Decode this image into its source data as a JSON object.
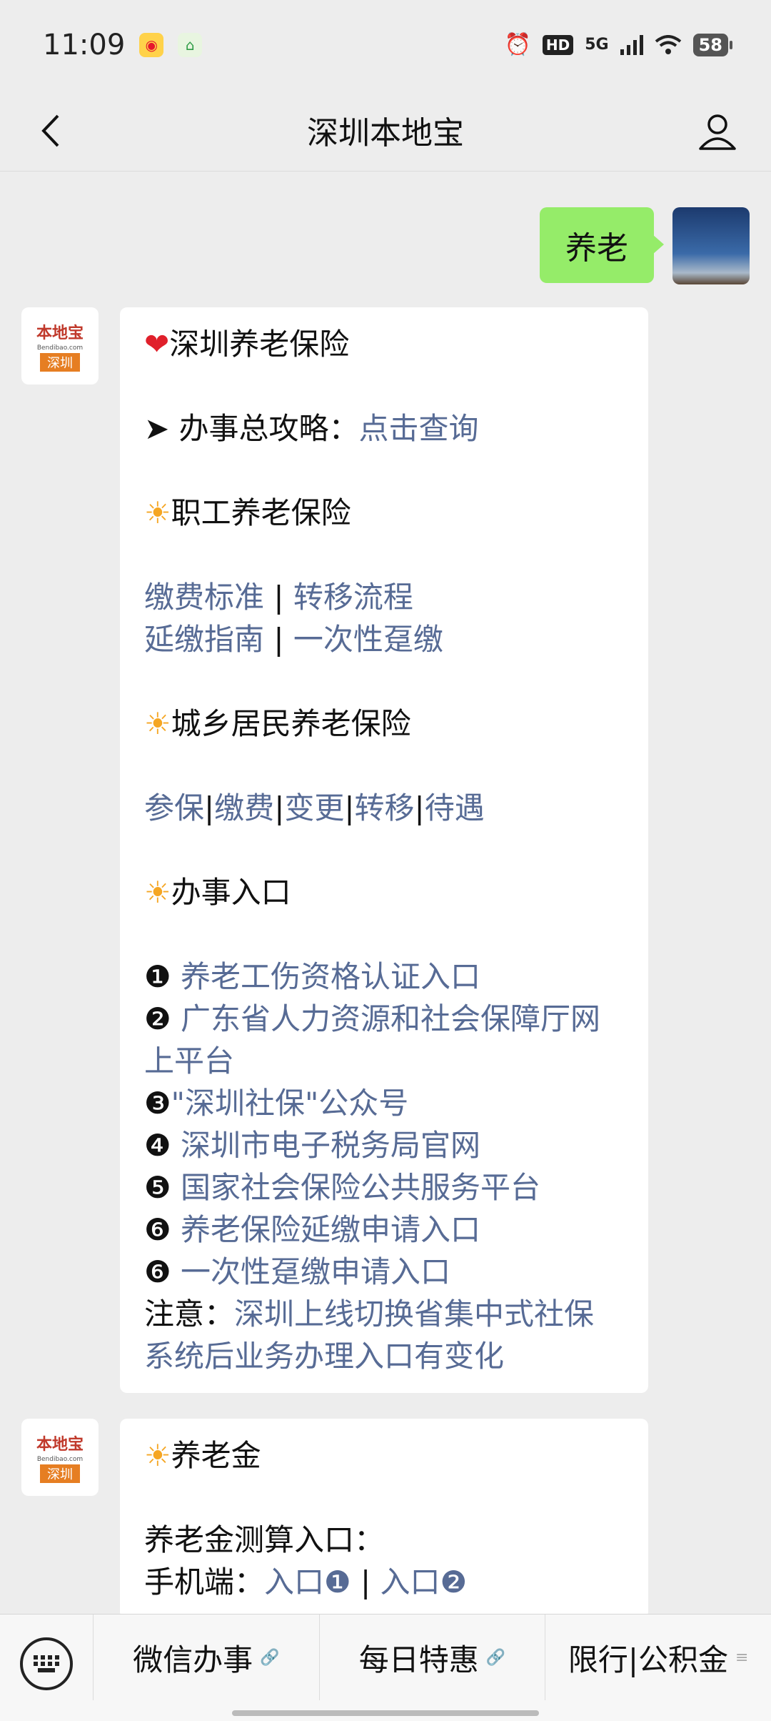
{
  "status_bar": {
    "time": "11:09",
    "app_icons": [
      "weibo-icon",
      "home-app-icon"
    ],
    "hd": "HD",
    "network": "5G",
    "battery": "58"
  },
  "header": {
    "title": "深圳本地宝",
    "back_icon": "chevron-left-icon",
    "profile_icon": "user-icon"
  },
  "self_message": {
    "text": "养老"
  },
  "bot": {
    "avatar_logo": "本地宝",
    "avatar_sub": "Bendibao.com",
    "avatar_city": "深圳"
  },
  "message1": {
    "title": "深圳养老保险",
    "guide_prefix": "➤ 办事总攻略：",
    "guide_link": "点击查询",
    "section1": "职工养老保险",
    "s1_links": [
      "缴费标准",
      "转移流程",
      "延缴指南",
      "一次性趸缴"
    ],
    "section2": "城乡居民养老保险",
    "s2_links": [
      "参保",
      "缴费",
      "变更",
      "转移",
      "待遇"
    ],
    "section3": "办事入口",
    "entries": [
      {
        "num": "❶",
        "text": "养老工伤资格认证入口"
      },
      {
        "num": "❷",
        "text": "广东省人力资源和社会保障厅网"
      },
      {
        "num": "",
        "text": "上平台"
      },
      {
        "num": "❸",
        "text": "\"深圳社保\"公众号"
      },
      {
        "num": "❹",
        "text": "深圳市电子税务局官网"
      },
      {
        "num": "❺",
        "text": "国家社会保险公共服务平台"
      },
      {
        "num": "❻",
        "text": "养老保险延缴申请入口"
      },
      {
        "num": "❻",
        "text": "一次性趸缴申请入口"
      }
    ],
    "note_prefix": "注意：",
    "note_line1": "深圳上线切换省集中式社保",
    "note_line2": "系统后业务办理入口有变化"
  },
  "message2": {
    "section": "养老金",
    "calc_label": "养老金测算入口：",
    "mobile_label": "手机端：",
    "entry1": "入口❶",
    "entry2": "入口❷"
  },
  "bottom_menu": {
    "keyboard_icon": "keyboard-icon",
    "items": [
      "微信办事",
      "每日特惠",
      "限行|公积金"
    ]
  },
  "colors": {
    "self_bubble": "#95ec69",
    "link": "#576b95",
    "background": "#ededed"
  }
}
